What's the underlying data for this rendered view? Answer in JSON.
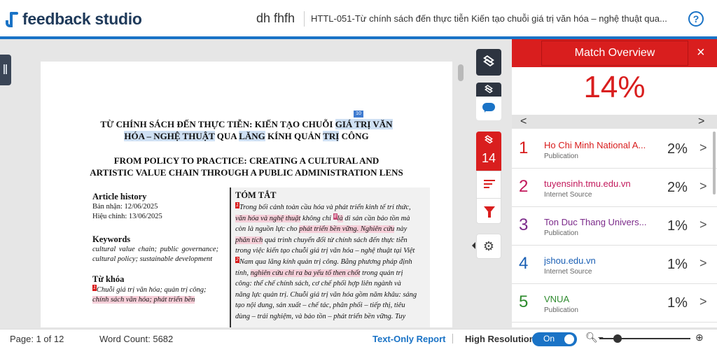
{
  "header": {
    "logo": "feedback studio",
    "owner": "dh fhfh",
    "document_title": "HTTL-051-Từ chính sách đến thực tiễn Kiến tạo chuỗi giá trị văn hóa – nghệ thuật qua...",
    "help": "?"
  },
  "document": {
    "title_vi_1a": "TỪ CHÍNH SÁCH ĐẾN THỰC TIỄN: KIẾN TẠO CHUỖI ",
    "title_vi_1b": "GIÁ TRỊ VĂN",
    "title_vi_2a": "HÓA – NGHỆ THUẬT",
    "title_vi_2b": " QUA ",
    "title_vi_2c": "LĂNG",
    "title_vi_2d": " KÍNH QUẢN ",
    "title_vi_2e": "TRỊ",
    "title_vi_2f": " CÔNG",
    "title_marker": "10",
    "title_en_1": "FROM POLICY TO PRACTICE: CREATING A CULTURAL AND",
    "title_en_2": "ARTISTIC VALUE CHAIN THROUGH A PUBLIC ADMINISTRATION LENS",
    "article_history_heading": "Article history",
    "received": "Bản nhận: 12/06/2025",
    "revised": "Hiệu chỉnh: 13/06/2025",
    "keywords_heading": "Keywords",
    "keywords": "cultural value chain; public governance; cultural policy; sustainable development",
    "tukhoa_heading": "Từ khóa",
    "tukhoa_1": "Chuỗi giá trị văn hóa; quản trị công;",
    "tukhoa_2": "chính sách văn hóa; phát triển bền",
    "abstract_heading": "TÓM TẮT",
    "abs_l1": "Trong bối cảnh toàn cầu hóa và phát triển kinh tế tri thức,",
    "abs_l2a": "văn hóa và nghệ thuật",
    "abs_l2b": " không chỉ ",
    "abs_l2c": "là",
    "abs_l2d": " di sản cần bảo tồn mà",
    "abs_l3a": "còn là nguồn lực cho ",
    "abs_l3b": "phát triển bền vững. Nghiên cứu",
    "abs_l3c": " này",
    "abs_l4a": "phân tích",
    "abs_l4b": " quá trình chuyển đổi từ chính sách đến thực tiễn",
    "abs_l5": "trong việc kiến tạo chuỗi giá trị văn hóa – nghệ thuật tại Việt",
    "abs_l6": "Nam qua lăng kính quản trị công. Bằng phương pháp định",
    "abs_l7a": "tính, ",
    "abs_l7b": "nghiên cứu chỉ ra ba yếu tố then chốt",
    "abs_l7c": " trong quản trị",
    "abs_l8": "công: thể chế chính sách, cơ chế phối hợp liên ngành và",
    "abs_l9": "năng lực quản trị. Chuỗi giá trị văn hóa gồm năm khâu: sáng",
    "abs_l10": "tạo nội dung, sản xuất – chế tác, phân phối – tiếp thị, tiêu",
    "abs_l11": "dùng – trải nghiệm, và bảo tồn – phát triển bền vững. Tuy",
    "mk_1": "1",
    "mk_8": "8",
    "mk_2": "2",
    "mk_4": "4"
  },
  "rail": {
    "match_count": "14"
  },
  "panel": {
    "title": "Match Overview",
    "close": "×",
    "overall_percent": "14%",
    "prev": "<",
    "next": ">",
    "matches": [
      {
        "num": "1",
        "name": "Ho Chi Minh National A...",
        "type": "Publication",
        "percent": "2%",
        "color": "#d81b1b"
      },
      {
        "num": "2",
        "name": "tuyensinh.tmu.edu.vn",
        "type": "Internet Source",
        "percent": "2%",
        "color": "#c2185b"
      },
      {
        "num": "3",
        "name": "Ton Duc Thang Univers...",
        "type": "Publication",
        "percent": "1%",
        "color": "#7b2a8a"
      },
      {
        "num": "4",
        "name": "jshou.edu.vn",
        "type": "Internet Source",
        "percent": "1%",
        "color": "#1a5fb4"
      },
      {
        "num": "5",
        "name": "VNUA",
        "type": "Publication",
        "percent": "1%",
        "color": "#2e8b2e"
      }
    ]
  },
  "footer": {
    "page": "Page: 1 of 12",
    "word_count": "Word Count: 5682",
    "text_only": "Text-Only Report",
    "high_res": "High Resolution",
    "toggle": "On"
  },
  "colors": {
    "brand_blue": "#1a73c6",
    "match_red": "#d91e1e"
  }
}
